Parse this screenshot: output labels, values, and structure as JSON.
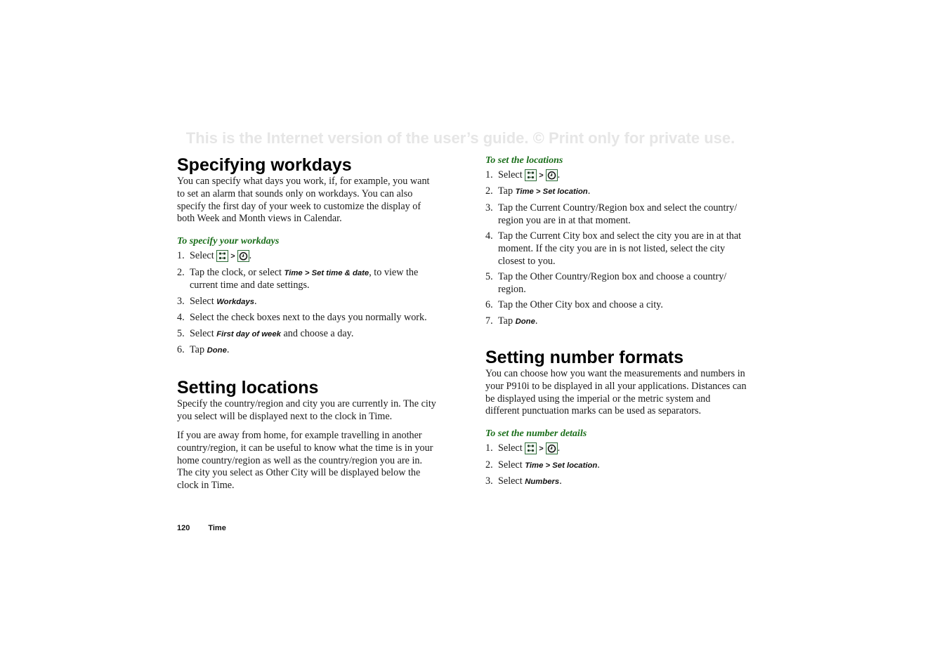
{
  "watermark": "This is the Internet version of the user’s guide. © Print only for private use.",
  "left": {
    "workdays": {
      "title": "Specifying workdays",
      "body": "You can specify what days you work, if, for example, you want to set an alarm that sounds only on workdays. You can also specify the first day of your week to customize the display of both Week and Month views in Calendar.",
      "procedure_title": "To specify your workdays",
      "steps": [
        {
          "num": "1.",
          "pre": "Select ",
          "icons": [
            "apps-grid-icon",
            "clock-icon"
          ],
          "sep": ">",
          "post": "."
        },
        {
          "num": "2.",
          "pre": "Tap the clock, or select ",
          "ui": "Time > Set time & date",
          "post": ", to view the current time and date settings."
        },
        {
          "num": "3.",
          "pre": "Select ",
          "ui": "Workdays",
          "post": "."
        },
        {
          "num": "4.",
          "pre": "Select the check boxes next to the days you normally work.",
          "ui": "",
          "post": ""
        },
        {
          "num": "5.",
          "pre": "Select ",
          "ui": "First day of week",
          "post": " and choose a day."
        },
        {
          "num": "6.",
          "pre": "Tap ",
          "ui": "Done",
          "post": "."
        }
      ]
    },
    "locations": {
      "title": "Setting locations",
      "body1": "Specify the country/region and city you are currently in. The city you select will be displayed next to the clock in Time.",
      "body2": "If you are away from home, for example travelling in another country/region, it can be useful to know what the time is in your home country/region as well as the country/region you are in. The city you select as Other City will be displayed below the clock in Time."
    }
  },
  "right": {
    "set_locations": {
      "procedure_title": "To set the locations",
      "steps": [
        {
          "num": "1.",
          "pre": "Select ",
          "icons": [
            "apps-grid-icon",
            "clock-icon"
          ],
          "sep": ">",
          "post": "."
        },
        {
          "num": "2.",
          "pre": "Tap ",
          "ui": "Time > Set location",
          "post": "."
        },
        {
          "num": "3.",
          "pre": "Tap the Current Country/Region box and select the country/ region you are in at that moment.",
          "ui": "",
          "post": ""
        },
        {
          "num": "4.",
          "pre": "Tap the Current City box and select the city you are in at that moment. If the city you are in is not listed, select the city closest to you.",
          "ui": "",
          "post": ""
        },
        {
          "num": "5.",
          "pre": "Tap the Other Country/Region box and choose a country/ region.",
          "ui": "",
          "post": ""
        },
        {
          "num": "6.",
          "pre": "Tap the Other City box and choose a city.",
          "ui": "",
          "post": ""
        },
        {
          "num": "7.",
          "pre": "Tap ",
          "ui": "Done",
          "post": "."
        }
      ]
    },
    "number_formats": {
      "title": "Setting number formats",
      "body": "You can choose how you want the measurements and numbers in your P910i to be displayed in all your applications. Distances can be displayed using the imperial or the metric system and different punctuation marks can be used as separators.",
      "procedure_title": "To set the number details",
      "steps": [
        {
          "num": "1.",
          "pre": "Select ",
          "icons": [
            "apps-grid-icon",
            "clock-icon"
          ],
          "sep": ">",
          "post": "."
        },
        {
          "num": "2.",
          "pre": "Select ",
          "ui": "Time > Set location",
          "post": "."
        },
        {
          "num": "3.",
          "pre": "Select ",
          "ui": "Numbers",
          "post": "."
        }
      ]
    }
  },
  "footer": {
    "page_number": "120",
    "section": "Time"
  },
  "colors": {
    "procedure_green": "#1a6e1a",
    "watermark_gray": "#e6e6e6",
    "icon_border": "#2f6e3a"
  }
}
